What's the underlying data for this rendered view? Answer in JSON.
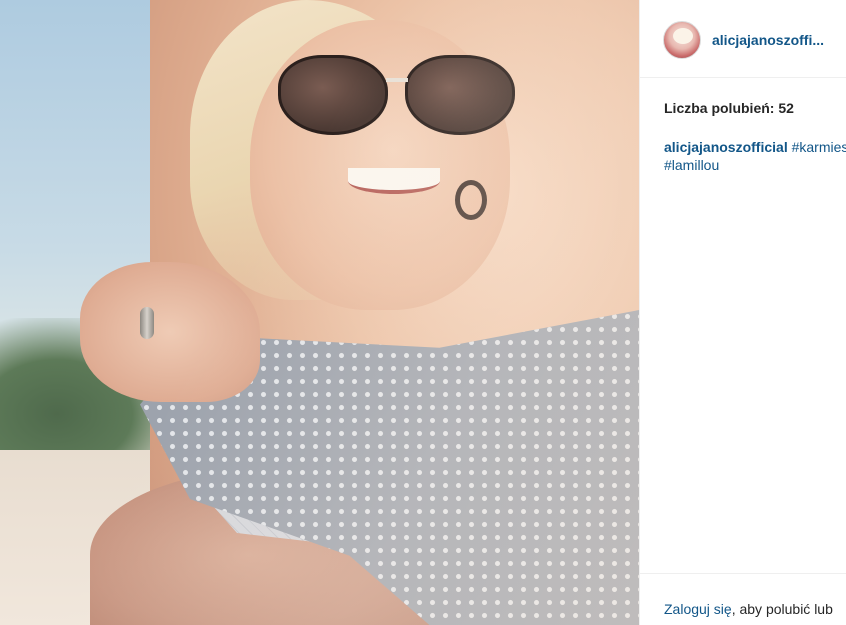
{
  "post": {
    "username": "alicjajanoszoffi...",
    "likes_text": "Liczba polubień: 52",
    "caption": {
      "user": "alicjajanoszofficial",
      "hashtag1": "#karmies",
      "hashtag2": "#lamillou"
    }
  },
  "footer": {
    "login_link": "Zaloguj się",
    "login_rest": ", aby polubić lub"
  },
  "colors": {
    "link": "#125688",
    "text": "#262626",
    "divider": "#efefef"
  },
  "icons": {
    "avatar": "profile-avatar"
  }
}
